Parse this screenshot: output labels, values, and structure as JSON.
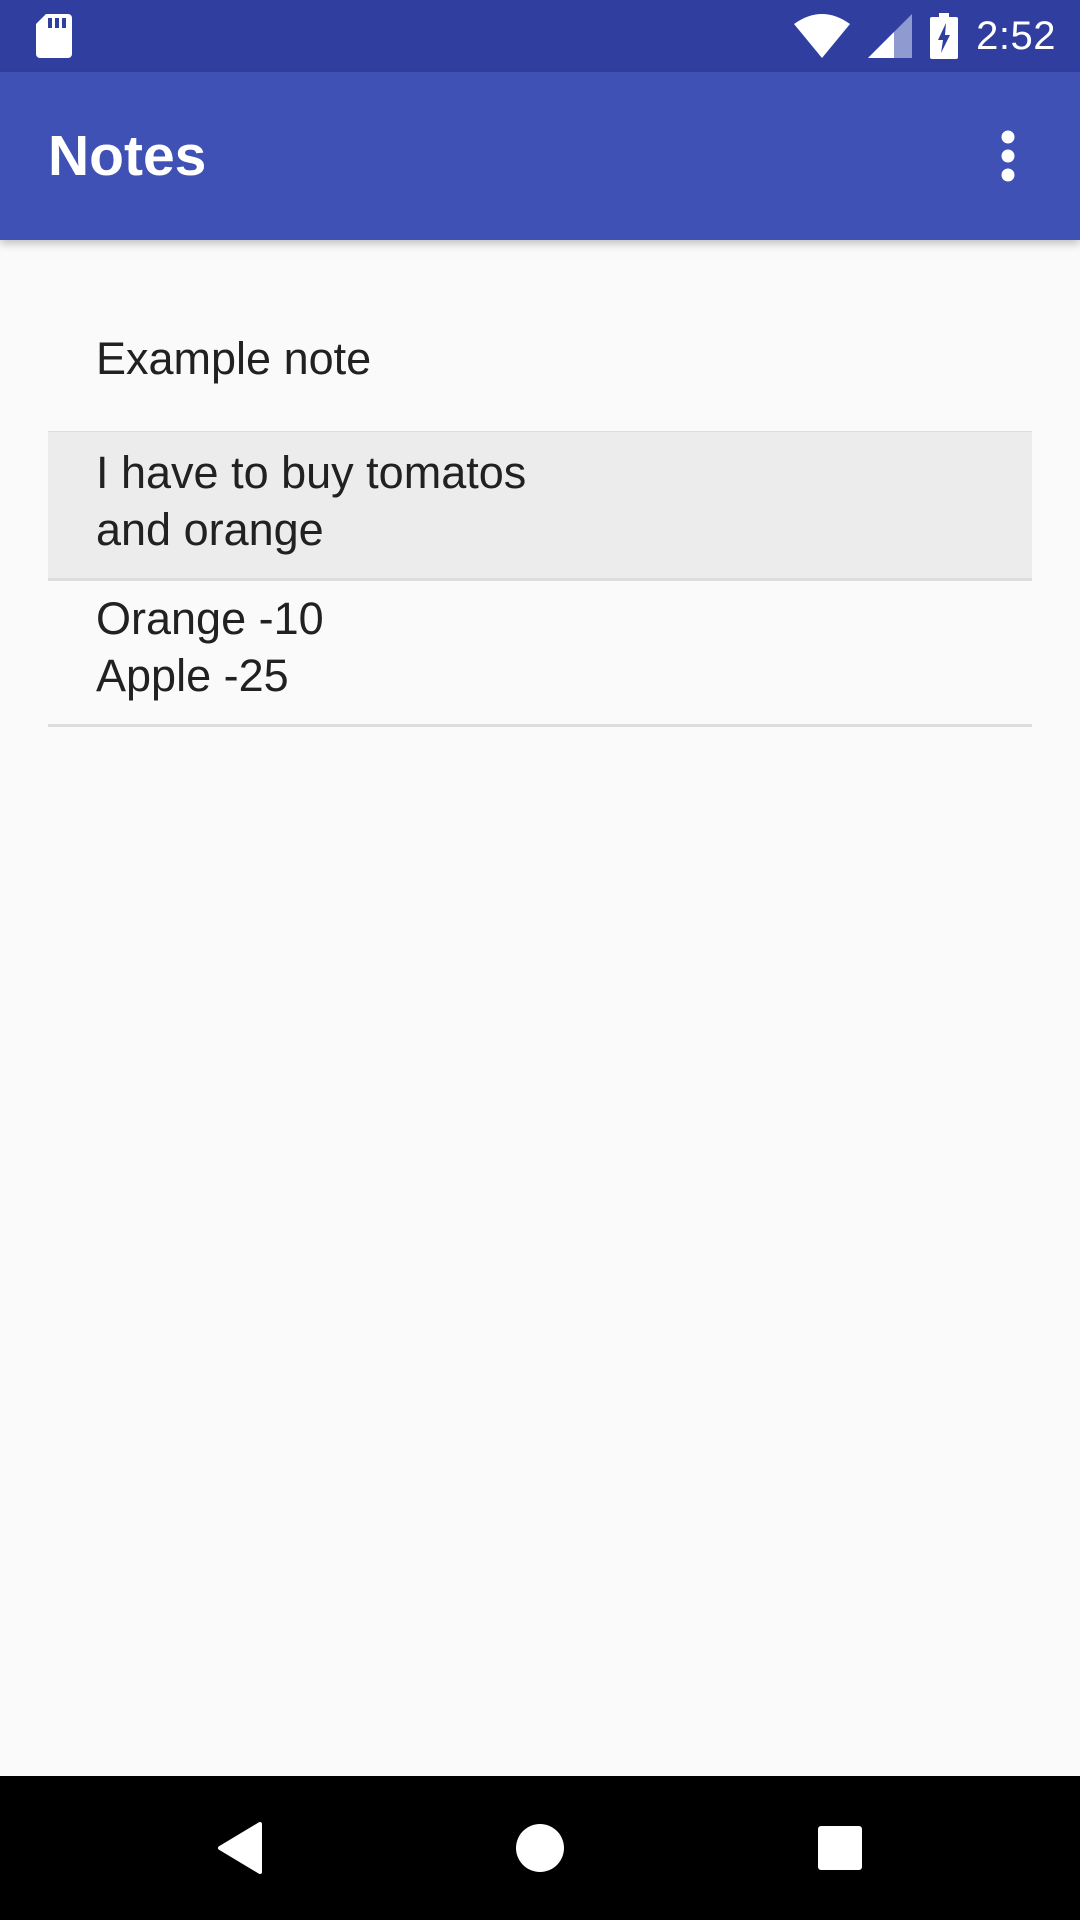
{
  "status_bar": {
    "time": "2:52",
    "left_icon": "sd-card-icon",
    "icons": [
      "wifi-icon",
      "cell-signal-icon",
      "battery-charging-icon"
    ]
  },
  "app_bar": {
    "title": "Notes",
    "menu_icon": "more-vert-icon"
  },
  "notes": [
    {
      "lines": [
        "Example note"
      ]
    },
    {
      "lines": [
        "I have to buy tomatos",
        "and orange"
      ],
      "selected": true
    },
    {
      "lines": [
        "Orange -10",
        "Apple -25"
      ]
    }
  ],
  "nav_bar": {
    "buttons": [
      "back-icon",
      "home-icon",
      "recents-icon"
    ]
  },
  "colors": {
    "status_bar": "#303f9f",
    "app_bar": "#3f51b5",
    "background": "#fafafa",
    "selected_row": "#ececec",
    "nav_bar": "#000000"
  }
}
